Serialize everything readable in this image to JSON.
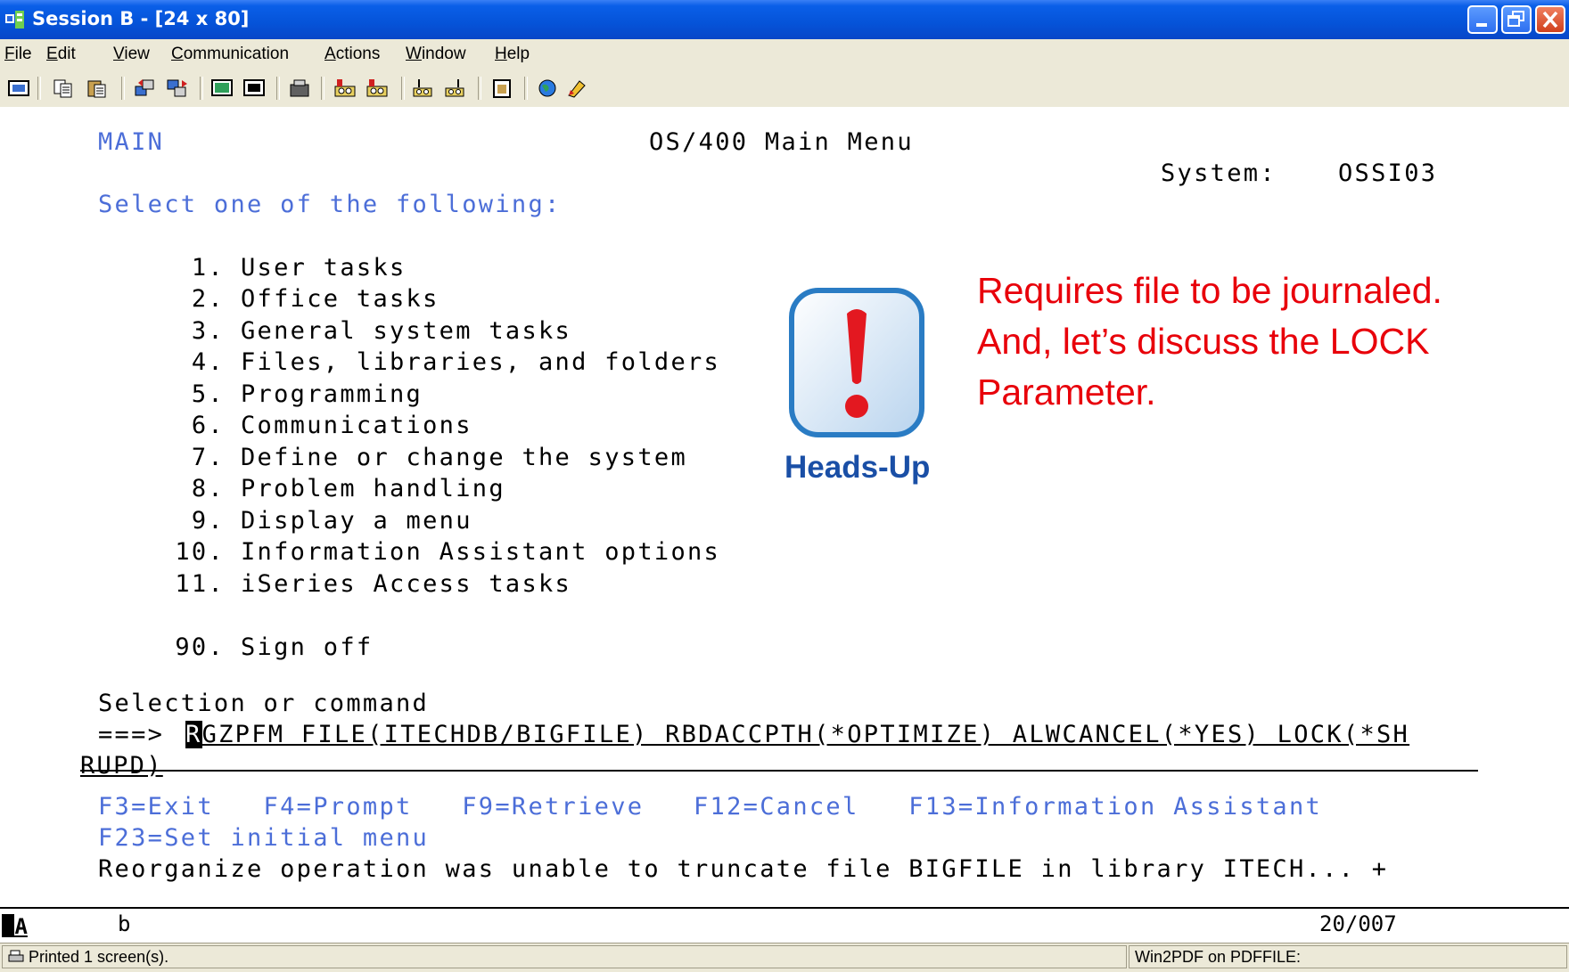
{
  "window": {
    "title": "Session B - [24 x 80]"
  },
  "menu": [
    "File",
    "Edit",
    "View",
    "Communication",
    "Actions",
    "Window",
    "Help"
  ],
  "toolbar_icons": [
    "print-screen-icon",
    "copy-icon",
    "paste-icon",
    "send-file-icon",
    "receive-file-icon",
    "display-icon",
    "keyboard-icon",
    "macro-icon",
    "record-macro-icon",
    "play-macro-icon",
    "connect-icon",
    "disconnect-icon",
    "clipboard-icon",
    "globe-icon",
    "edit-icon"
  ],
  "screen": {
    "menu_id": "MAIN",
    "title": "OS/400 Main Menu",
    "system_label": "System:",
    "system_value": "OSSI03",
    "instruction": "Select one of the following:",
    "options": [
      {
        "num": "1.",
        "label": "User tasks"
      },
      {
        "num": "2.",
        "label": "Office tasks"
      },
      {
        "num": "3.",
        "label": "General system tasks"
      },
      {
        "num": "4.",
        "label": "Files, libraries, and folders"
      },
      {
        "num": "5.",
        "label": "Programming"
      },
      {
        "num": "6.",
        "label": "Communications"
      },
      {
        "num": "7.",
        "label": "Define or change the system"
      },
      {
        "num": "8.",
        "label": "Problem handling"
      },
      {
        "num": "9.",
        "label": "Display a menu"
      },
      {
        "num": "10.",
        "label": "Information Assistant options"
      },
      {
        "num": "11.",
        "label": "iSeries Access tasks"
      }
    ],
    "signoff": {
      "num": "90.",
      "label": "Sign off"
    },
    "selection_label": "Selection or command",
    "prompt": "===>",
    "command_first_char": "R",
    "command_rest": "GZPFM FILE(ITECHDB/BIGFILE) RBDACCPTH(*OPTIMIZE) ALWCANCEL(*YES) LOCK(*SH",
    "command_wrap": "RUPD)",
    "fkeys_line1": "F3=Exit   F4=Prompt   F9=Retrieve   F12=Cancel   F13=Information Assistant",
    "fkeys_line2": "F23=Set initial menu",
    "message": "Reorganize operation was unable to truncate file BIGFILE in library ITECH... +"
  },
  "callout": {
    "line1": "Requires file to be journaled.",
    "line2": "And, let’s discuss the LOCK",
    "line3": "Parameter.",
    "badge_label": "Heads-Up",
    "badge_symbol": "!"
  },
  "status_line": {
    "indicator": "MA",
    "field": "b",
    "position": "20/007"
  },
  "status_bar": {
    "left": "Printed 1 screen(s).",
    "right": "Win2PDF on PDFFILE:"
  }
}
